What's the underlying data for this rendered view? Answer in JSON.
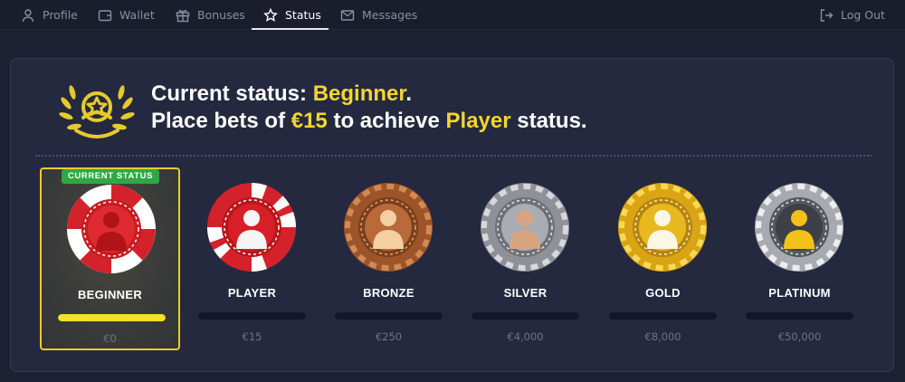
{
  "nav": {
    "items": [
      {
        "label": "Profile",
        "icon": "user-icon"
      },
      {
        "label": "Wallet",
        "icon": "wallet-icon"
      },
      {
        "label": "Bonuses",
        "icon": "gift-icon"
      },
      {
        "label": "Status",
        "icon": "star-icon",
        "active": true
      },
      {
        "label": "Messages",
        "icon": "mail-icon"
      }
    ],
    "logout": {
      "label": "Log Out",
      "icon": "logout-icon"
    }
  },
  "status": {
    "line1_prefix": "Current status: ",
    "line1_status": "Beginner",
    "line1_suffix": ".",
    "line2_prefix": "Place bets of ",
    "line2_amount": "€15",
    "line2_middle": " to achieve ",
    "line2_next": "Player",
    "line2_suffix": " status."
  },
  "current_badge": "CURRENT STATUS",
  "tiers": [
    {
      "name": "BEGINNER",
      "amount": "€0",
      "progress": 1.0,
      "current": true
    },
    {
      "name": "PLAYER",
      "amount": "€15",
      "progress": 0
    },
    {
      "name": "BRONZE",
      "amount": "€250",
      "progress": 0
    },
    {
      "name": "SILVER",
      "amount": "€4,000",
      "progress": 0
    },
    {
      "name": "GOLD",
      "amount": "€8,000",
      "progress": 0
    },
    {
      "name": "PLATINUM",
      "amount": "€50,000",
      "progress": 0
    }
  ],
  "colors": {
    "accent_yellow": "#f2d531",
    "badge_green": "#2fa843",
    "panel_bg": "#24293f"
  }
}
